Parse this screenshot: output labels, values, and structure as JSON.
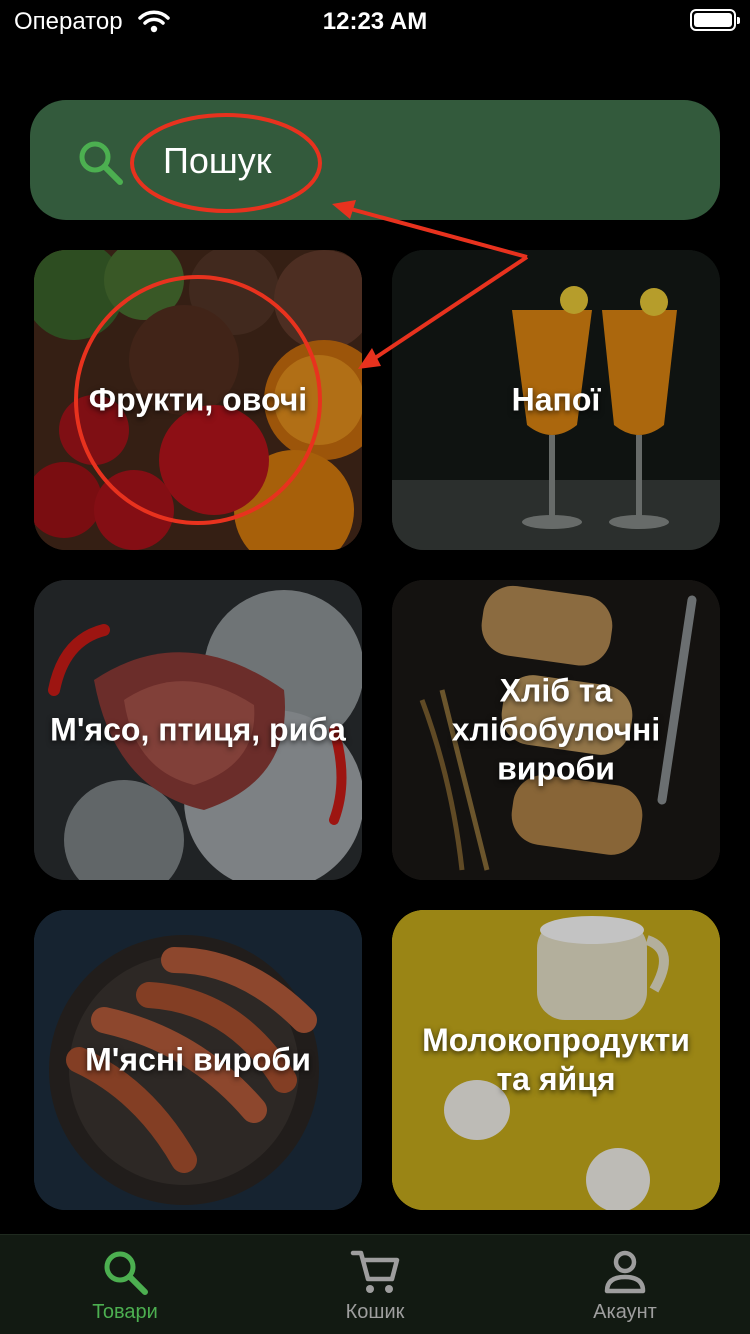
{
  "status_bar": {
    "carrier": "Оператор",
    "time": "12:23 AM",
    "wifi_icon": "wifi-icon",
    "battery_icon": "battery-icon"
  },
  "search": {
    "placeholder": "Пошук",
    "icon": "search-icon",
    "background": "#335a3c",
    "icon_color": "#4caf50"
  },
  "categories": [
    {
      "label": "Фрукти, овочі",
      "image": "fruits-vegetables-photo"
    },
    {
      "label": "Напої",
      "image": "drinks-photo"
    },
    {
      "label": "М'ясо, птиця, риба",
      "image": "meat-poultry-fish-photo"
    },
    {
      "label": "Хліб та хлібобулочні вироби",
      "image": "bread-bakery-photo"
    },
    {
      "label": "М'ясні вироби",
      "image": "sausages-photo"
    },
    {
      "label": "Молокопродукти та яйця",
      "image": "dairy-eggs-photo"
    }
  ],
  "tab_bar": {
    "active_color": "#4caf50",
    "inactive_color": "#9e9e9e",
    "tabs": [
      {
        "label": "Товари",
        "icon": "search-icon",
        "active": true
      },
      {
        "label": "Кошик",
        "icon": "cart-icon",
        "active": false
      },
      {
        "label": "Акаунт",
        "icon": "account-icon",
        "active": false
      }
    ]
  },
  "annotation": {
    "color": "#e8321e"
  }
}
